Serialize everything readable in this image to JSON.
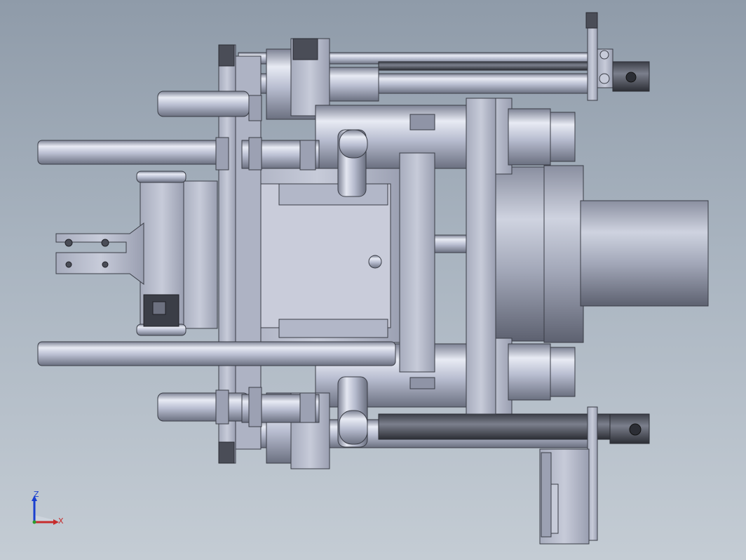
{
  "viewport": {
    "background_top": "#8f9ba9",
    "background_bottom": "#c4ccd4"
  },
  "triad": {
    "z_label": "Z",
    "x_label": "X",
    "z_color": "#1a3fcf",
    "x_color": "#c72c2c",
    "y_color": "#2b9c2b"
  },
  "model": {
    "description_icon": "mold-assembly-3d-model",
    "metal_color": "#b9bfd2",
    "dark_metal_color": "#4a4d57"
  }
}
